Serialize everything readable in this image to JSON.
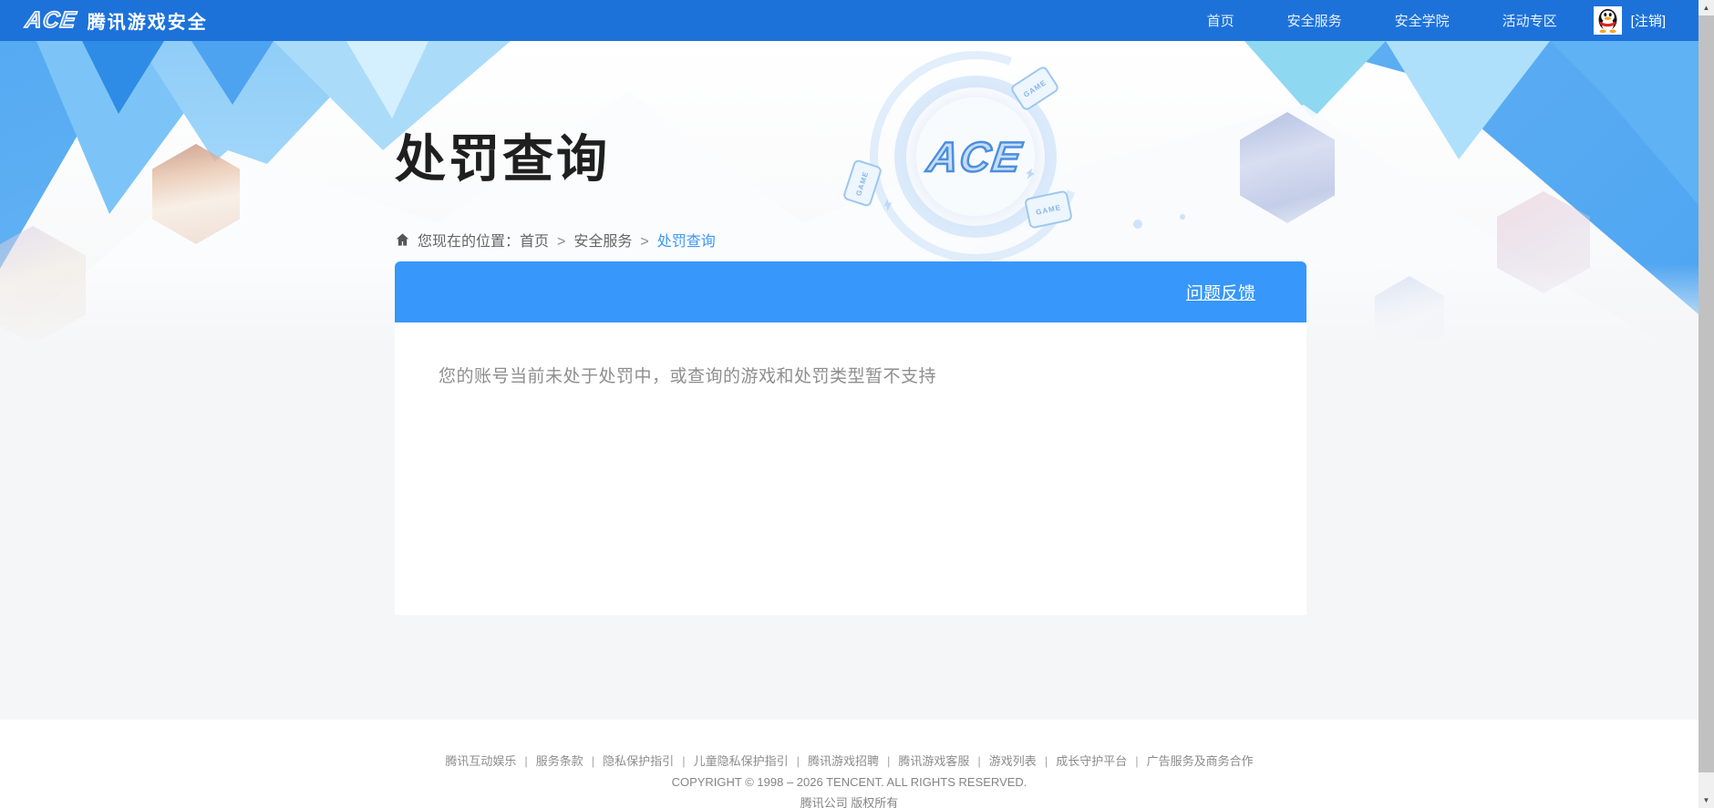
{
  "nav": {
    "logo_mark": "ACE",
    "brand": "腾讯游戏安全",
    "items": [
      "首页",
      "安全服务",
      "安全学院",
      "活动专区"
    ],
    "logout": "[注销]"
  },
  "page": {
    "title": "处罚查询",
    "breadcrumb_label": "您现在的位置：",
    "breadcrumb": [
      "首页",
      "安全服务",
      "处罚查询"
    ]
  },
  "panel": {
    "feedback": "问题反馈",
    "message": "您的账号当前未处于处罚中，或查询的游戏和处罚类型暂不支持"
  },
  "emblem": {
    "text": "ACE",
    "tile": "GAME"
  },
  "footer": {
    "links": [
      "腾讯互动娱乐",
      "服务条款",
      "隐私保护指引",
      "儿童隐私保护指引",
      "腾讯游戏招聘",
      "腾讯游戏客服",
      "游戏列表",
      "成长守护平台",
      "广告服务及商务合作"
    ],
    "copyright": "COPYRIGHT © 1998 – 2026 TENCENT. ALL RIGHTS RESERVED.",
    "company": "腾讯公司 版权所有"
  },
  "colors": {
    "nav_bg": "#1d72da",
    "banner_bg": "#3797fa",
    "link_blue": "#3b97fa"
  }
}
